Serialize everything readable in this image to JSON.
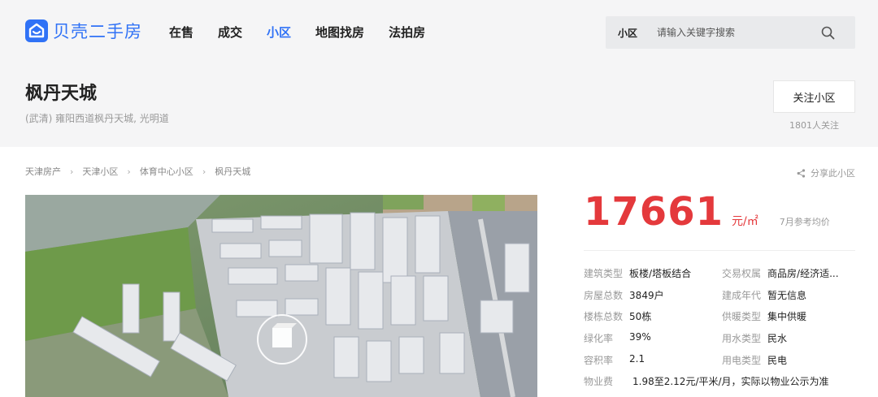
{
  "brand": {
    "name": "贝壳二手房",
    "color": "#3072f6"
  },
  "nav": [
    {
      "label": "在售",
      "active": false
    },
    {
      "label": "成交",
      "active": false
    },
    {
      "label": "小区",
      "active": true
    },
    {
      "label": "地图找房",
      "active": false
    },
    {
      "label": "法拍房",
      "active": false
    }
  ],
  "search": {
    "scope": "小区",
    "placeholder": "请输入关键字搜索",
    "icon": "search-icon"
  },
  "community": {
    "name": "枫丹天城",
    "address": "(武清) 雍阳西道枫丹天城, 光明道",
    "follow_label": "关注小区",
    "follow_count": "1801人关注"
  },
  "breadcrumb": [
    "天津房产",
    "天津小区",
    "体育中心小区",
    "枫丹天城"
  ],
  "share_label": "分享此小区",
  "price": {
    "value": "17661",
    "unit": "元/㎡",
    "note": "7月参考均价",
    "color": "#e4393c"
  },
  "info": {
    "rows": [
      {
        "k1": "建筑类型",
        "v1": "板楼/塔板结合",
        "k2": "交易权属",
        "v2": "商品房/经济适..."
      },
      {
        "k1": "房屋总数",
        "v1": "3849户",
        "k2": "建成年代",
        "v2": "暂无信息"
      },
      {
        "k1": "楼栋总数",
        "v1": "50栋",
        "k2": "供暖类型",
        "v2": "集中供暖"
      },
      {
        "k1": "绿化率",
        "v1": "39%",
        "k2": "用水类型",
        "v2": "民水"
      },
      {
        "k1": "容积率",
        "v1": "2.1",
        "k2": "用电类型",
        "v2": "民电"
      }
    ],
    "fee_label": "物业费",
    "fee_value": "1.98至2.12元/平米/月，实际以物业公示为准"
  }
}
